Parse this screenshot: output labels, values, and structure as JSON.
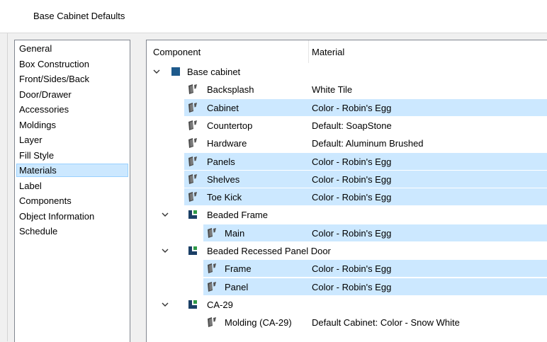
{
  "window": {
    "title": "Base Cabinet Defaults"
  },
  "nav": {
    "items": [
      {
        "label": "General",
        "selected": false
      },
      {
        "label": "Box Construction",
        "selected": false
      },
      {
        "label": "Front/Sides/Back",
        "selected": false
      },
      {
        "label": "Door/Drawer",
        "selected": false
      },
      {
        "label": "Accessories",
        "selected": false
      },
      {
        "label": "Moldings",
        "selected": false
      },
      {
        "label": "Layer",
        "selected": false
      },
      {
        "label": "Fill Style",
        "selected": false
      },
      {
        "label": "Materials",
        "selected": true
      },
      {
        "label": "Label",
        "selected": false
      },
      {
        "label": "Components",
        "selected": false
      },
      {
        "label": "Object Information",
        "selected": false
      },
      {
        "label": "Schedule",
        "selected": false
      }
    ]
  },
  "tree": {
    "headers": {
      "component": "Component",
      "material": "Material"
    },
    "rows": [
      {
        "level": 0,
        "type": "group",
        "icon": "square-blue-icon",
        "label": "Base cabinet",
        "material": "",
        "selected": false,
        "expanded": true
      },
      {
        "level": 1,
        "type": "item",
        "icon": "material-paint-icon",
        "label": "Backsplash",
        "material": "White Tile",
        "selected": false
      },
      {
        "level": 1,
        "type": "item",
        "icon": "material-paint-icon",
        "label": "Cabinet",
        "material": "Color - Robin's Egg",
        "selected": true
      },
      {
        "level": 1,
        "type": "item",
        "icon": "material-paint-icon",
        "label": "Countertop",
        "material": "Default: SoapStone",
        "selected": false
      },
      {
        "level": 1,
        "type": "item",
        "icon": "material-paint-icon",
        "label": "Hardware",
        "material": "Default: Aluminum Brushed",
        "selected": false
      },
      {
        "level": 1,
        "type": "item",
        "icon": "material-paint-icon",
        "label": "Panels",
        "material": "Color - Robin's Egg",
        "selected": true
      },
      {
        "level": 1,
        "type": "item",
        "icon": "material-paint-icon",
        "label": "Shelves",
        "material": "Color - Robin's Egg",
        "selected": true
      },
      {
        "level": 1,
        "type": "item",
        "icon": "material-paint-icon",
        "label": "Toe Kick",
        "material": "Color - Robin's Egg",
        "selected": true
      },
      {
        "level": 1,
        "type": "group",
        "icon": "component-green-icon",
        "label": "Beaded Frame",
        "material": "",
        "selected": false,
        "expanded": true
      },
      {
        "level": 2,
        "type": "item",
        "icon": "material-paint-icon",
        "label": "Main",
        "material": "Color - Robin's Egg",
        "selected": true
      },
      {
        "level": 1,
        "type": "group",
        "icon": "component-green-icon",
        "label": "Beaded Recessed Panel Door",
        "material": "",
        "selected": false,
        "expanded": true
      },
      {
        "level": 2,
        "type": "item",
        "icon": "material-paint-icon",
        "label": "Frame",
        "material": "Color - Robin's Egg",
        "selected": true
      },
      {
        "level": 2,
        "type": "item",
        "icon": "material-paint-icon",
        "label": "Panel",
        "material": "Color - Robin's Egg",
        "selected": true
      },
      {
        "level": 1,
        "type": "group",
        "icon": "component-green-icon",
        "label": "CA-29",
        "material": "",
        "selected": false,
        "expanded": true
      },
      {
        "level": 2,
        "type": "item",
        "icon": "material-paint-icon",
        "label": "Molding (CA-29)",
        "material": "Default Cabinet: Color - Snow White",
        "selected": false
      }
    ]
  },
  "colors": {
    "selection": "#cce8ff",
    "nav_selection_border": "#99d1ff",
    "group_blue": "#1e5a8c",
    "component_green": "#2f9a47",
    "component_navy": "#1b3f66"
  }
}
